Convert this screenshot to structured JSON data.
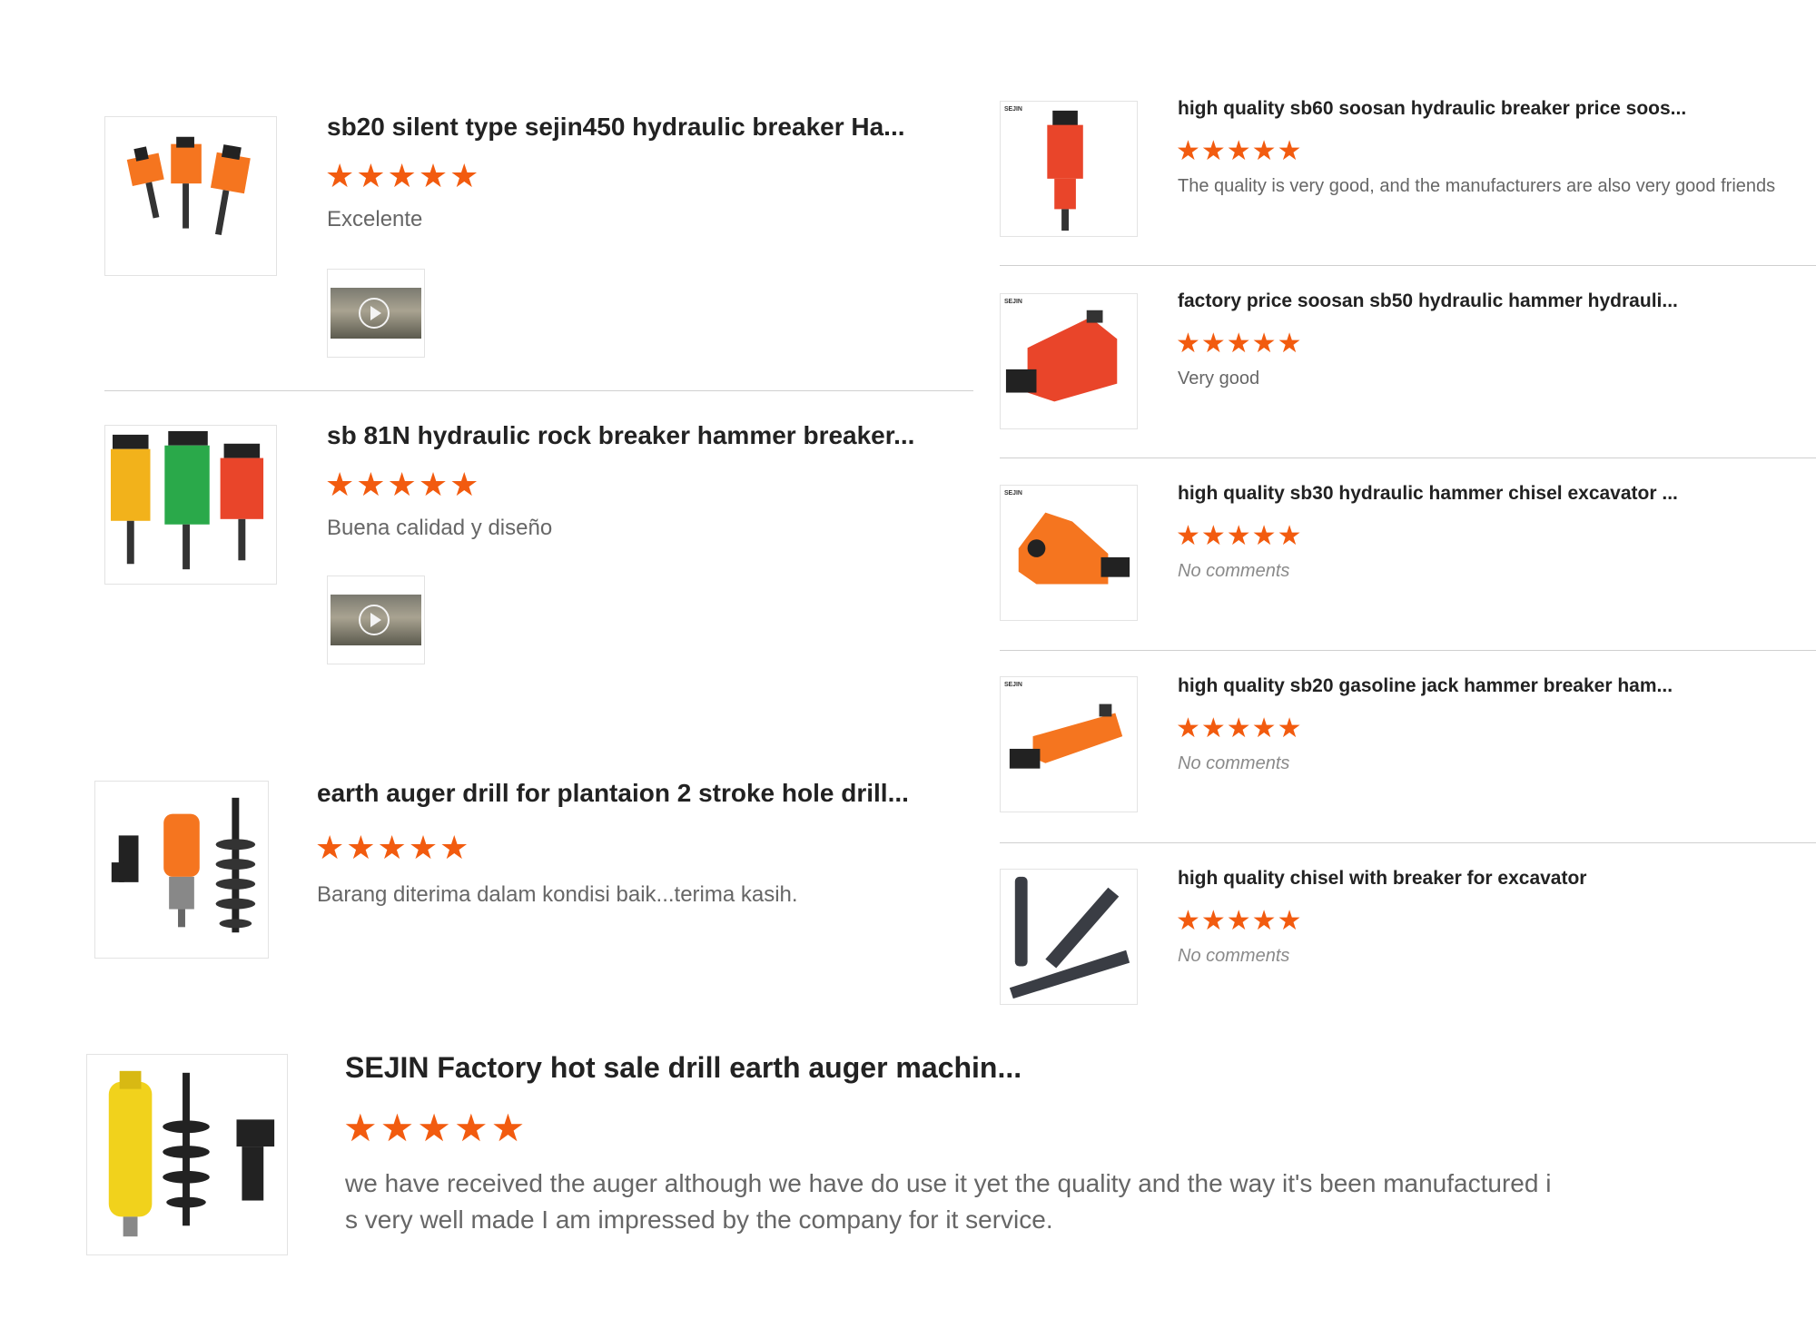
{
  "colors": {
    "star": "#f25b0f",
    "orange": "#f5751f",
    "red": "#e9452a",
    "title": "#222222",
    "comment": "#666666"
  },
  "left_reviews": [
    {
      "title": "sb20 silent type sejin450 hydraulic breaker Ha...",
      "stars": "★★★★★",
      "comment": "Excelente",
      "has_video": true,
      "icon": "orange-breakers-image"
    },
    {
      "title": "sb 81N hydraulic rock breaker hammer breaker...",
      "stars": "★★★★★",
      "comment": "Buena calidad y diseño",
      "has_video": true,
      "icon": "yellow-green-red-breakers-image"
    },
    {
      "title": "earth auger drill for plantaion 2 stroke hole drill...",
      "stars": "★★★★★",
      "comment": "Barang diterima dalam kondisi baik...terima kasih.",
      "has_video": false,
      "icon": "orange-auger-image"
    }
  ],
  "bottom_review": {
    "title": "SEJIN Factory hot sale drill earth auger machin...",
    "stars": "★★★★★",
    "comment_line1": "we have received the auger although we have do use it yet the quality and the way it's been manufactured i",
    "comment_line2": "s very well made I am impressed by the company for it service.",
    "icon": "yellow-auger-image"
  },
  "right_reviews": [
    {
      "title": "high quality sb60 soosan hydraulic breaker price soos...",
      "stars": "★★★★★",
      "comment": "The quality is very good, and the manufacturers are also very good friends",
      "brand": "SEJIN",
      "icon": "red-top-breaker-image"
    },
    {
      "title": "factory price soosan sb50 hydraulic hammer hydrauli...",
      "stars": "★★★★★",
      "comment": "Very good",
      "brand": "SEJIN",
      "icon": "red-side-breaker-image"
    },
    {
      "title": "high quality sb30 hydraulic hammer chisel excavator ...",
      "stars": "★★★★★",
      "comment": "No comments",
      "brand": "SEJIN",
      "icon": "orange-side-breaker-image"
    },
    {
      "title": "high quality sb20 gasoline jack hammer breaker ham...",
      "stars": "★★★★★",
      "comment": "No comments",
      "brand": "SEJIN",
      "icon": "orange-small-breaker-image"
    },
    {
      "title": "high quality chisel with breaker for excavator",
      "stars": "★★★★★",
      "comment": "No comments",
      "brand": "",
      "icon": "chisels-image"
    }
  ]
}
